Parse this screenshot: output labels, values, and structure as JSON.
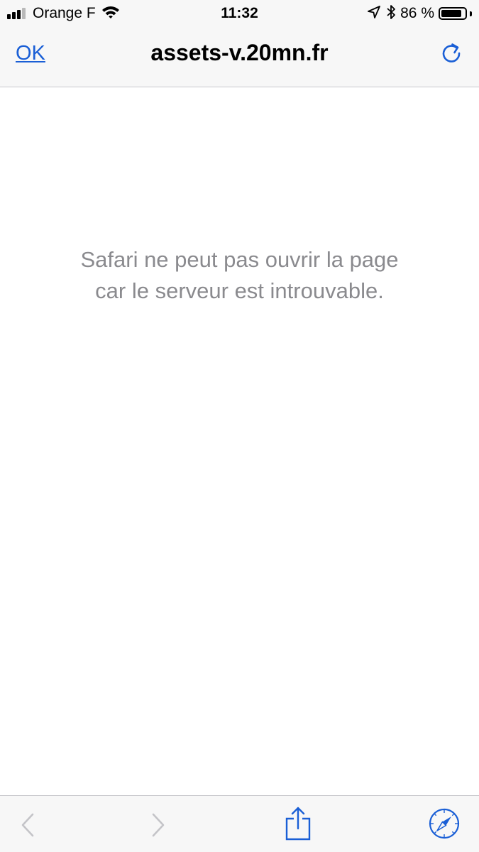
{
  "status_bar": {
    "carrier": "Orange F",
    "time": "11:32",
    "battery_percent": "86 %",
    "battery_level": 0.86,
    "signal_bars_active": 3,
    "signal_bars_total": 4
  },
  "nav_bar": {
    "done_label": "OK",
    "title": "assets-v.20mn.fr",
    "reload_icon": "reload-icon"
  },
  "content": {
    "error_line1": "Safari ne peut pas ouvrir la page",
    "error_line2": "car le serveur est introuvable."
  },
  "toolbar": {
    "back_icon": "chevron-left-icon",
    "forward_icon": "chevron-right-icon",
    "share_icon": "share-icon",
    "safari_icon": "compass-icon"
  },
  "colors": {
    "accent": "#1a5fd6",
    "message_text": "#8a8a8e",
    "disabled_icon": "#c4c4c8",
    "bar_background": "#f7f7f7"
  }
}
